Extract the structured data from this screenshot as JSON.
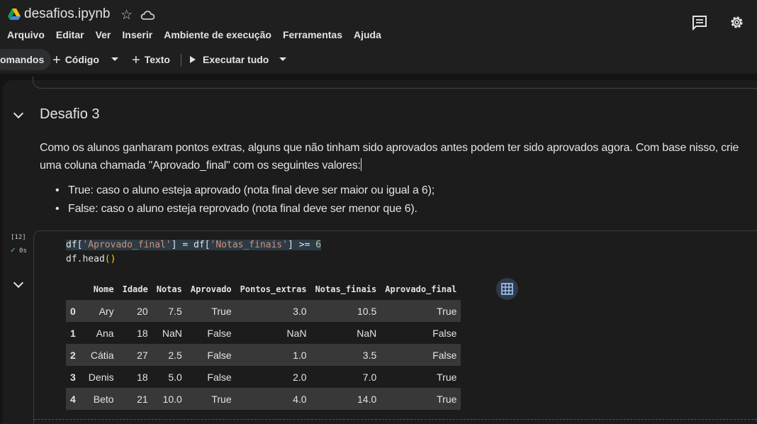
{
  "app": {
    "title": "desafios.ipynb",
    "menu": [
      "Arquivo",
      "Editar",
      "Ver",
      "Inserir",
      "Ambiente de execução",
      "Ferramentas",
      "Ajuda"
    ]
  },
  "toolbar": {
    "commands_label": "omandos",
    "code_label": "Código",
    "text_label": "Texto",
    "run_all_label": "Executar tudo"
  },
  "text_cell": {
    "heading": "Desafio 3",
    "paragraph": "Como os alunos ganharam pontos extras, alguns que não tinham sido aprovados antes podem ter sido aprovados agora. Com base nisso, crie uma coluna chamada \"Aprovado_final\" com os seguintes valores:",
    "bullets": [
      "True: caso o aluno esteja aprovado (nota final deve ser maior ou igual a 6);",
      "False: caso o aluno esteja reprovado (nota final deve ser menor que 6)."
    ]
  },
  "code_cell": {
    "exec_count": "[12]",
    "exec_time": "0s",
    "line1_a": "df[",
    "line1_b": "'Aprovado_final'",
    "line1_c": "] = df[",
    "line1_d": "'Notas_finais'",
    "line1_e": "] >= ",
    "line1_f": "6",
    "line2_a": "df.head",
    "line2_b": "()"
  },
  "output_table": {
    "columns": [
      "",
      "Nome",
      "Idade",
      "Notas",
      "Aprovado",
      "Pontos_extras",
      "Notas_finais",
      "Aprovado_final"
    ],
    "rows": [
      [
        "0",
        "Ary",
        "20",
        "7.5",
        "True",
        "3.0",
        "10.5",
        "True"
      ],
      [
        "1",
        "Ana",
        "18",
        "NaN",
        "False",
        "NaN",
        "NaN",
        "False"
      ],
      [
        "2",
        "Cátia",
        "27",
        "2.5",
        "False",
        "1.0",
        "3.5",
        "False"
      ],
      [
        "3",
        "Denis",
        "18",
        "5.0",
        "False",
        "2.0",
        "7.0",
        "True"
      ],
      [
        "4",
        "Beto",
        "21",
        "10.0",
        "True",
        "4.0",
        "14.0",
        "True"
      ]
    ]
  },
  "icons": {
    "logo": "colab-logo-icon",
    "star": "star-icon",
    "cloud": "cloud-icon",
    "comment": "comment-icon",
    "settings": "gear-icon",
    "table": "table-icon"
  }
}
